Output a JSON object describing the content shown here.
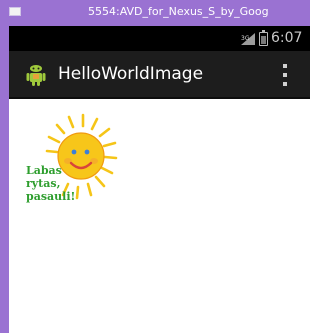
{
  "window": {
    "title": "5554:AVD_for_Nexus_S_by_Goog",
    "icon": "emulator-window-icon"
  },
  "status_bar": {
    "time": "6:07",
    "icons": [
      "signal-icon",
      "battery-icon"
    ]
  },
  "action_bar": {
    "app_icon": "android-robot-icon",
    "title": "HelloWorldImage",
    "menu_icon": "overflow-menu-icon"
  },
  "content": {
    "image": "smiling-sun",
    "greeting_lines": [
      "Labas",
      "rytas,",
      "pasauli!"
    ]
  },
  "colors": {
    "frame": "#9a72d2",
    "status_bar": "#000000",
    "action_bar": "#1d1d1d",
    "greeting_text": "#2e9e2e",
    "sun": "#f5c518"
  }
}
